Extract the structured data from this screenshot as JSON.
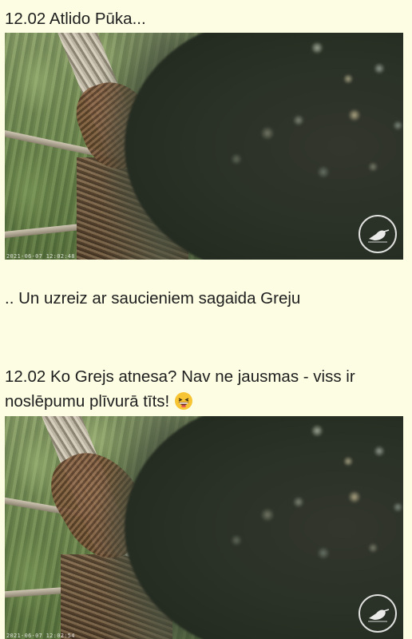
{
  "posts": [
    {
      "text": "12.02 Atlido Pūka...",
      "timestamp": "2021-06-07 12:02:48"
    },
    {
      "text": ".. Un uzreiz ar saucieniem sagaida Greju"
    },
    {
      "text": "12.02 Ko Grejs atnesa? Nav ne jausmas - viss ir noslēpumu plīvurā tīts!",
      "emoji": "grinning-squinting-face",
      "timestamp": "2021-06-07 12:02:54"
    }
  ],
  "icons": {
    "logo": "kingfisher-logo-icon"
  },
  "colors": {
    "background": "#fdfde4",
    "text": "#1e1e1e"
  }
}
